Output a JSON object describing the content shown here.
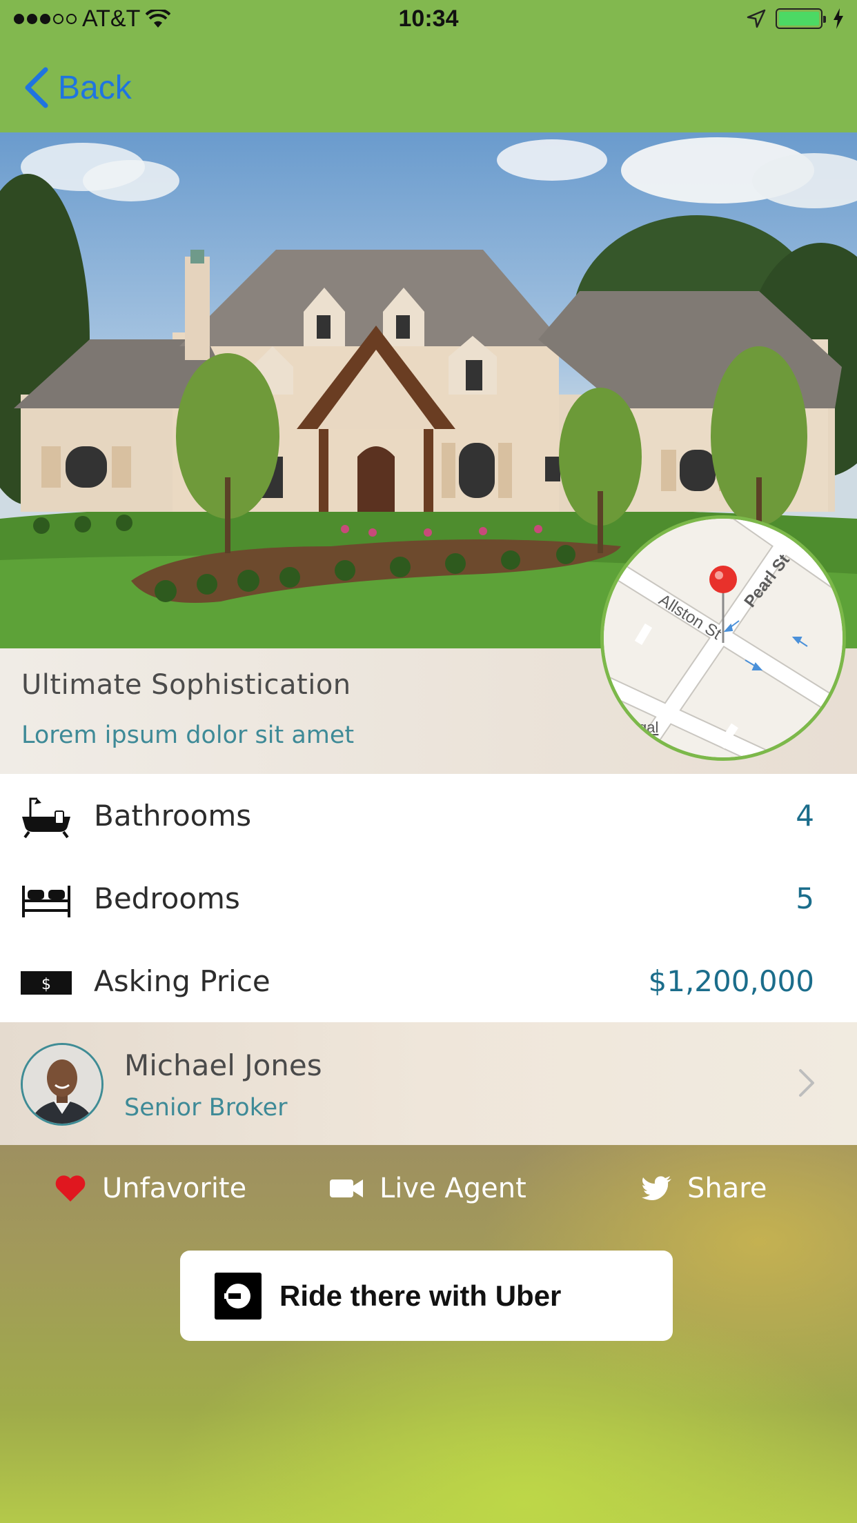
{
  "status_bar": {
    "carrier": "AT&T",
    "time": "10:34"
  },
  "nav": {
    "back_label": "Back"
  },
  "listing": {
    "title": "Ultimate Sophistication",
    "subtitle": "Lorem ipsum dolor sit amet"
  },
  "map": {
    "streets": [
      "Pearl St",
      "Allston St"
    ],
    "legal_fragment": "gal"
  },
  "details": [
    {
      "label": "Bathrooms",
      "value": "4",
      "icon": "bathtub-icon"
    },
    {
      "label": "Bedrooms",
      "value": "5",
      "icon": "bed-icon"
    },
    {
      "label": "Asking Price",
      "value": "$1,200,000",
      "icon": "dollar-bill-icon"
    }
  ],
  "agent": {
    "name": "Michael Jones",
    "role": "Senior Broker"
  },
  "actions": {
    "favorite_label": "Unfavorite",
    "live_agent_label": "Live Agent",
    "share_label": "Share"
  },
  "uber": {
    "label": "Ride there with Uber"
  },
  "colors": {
    "nav_green": "#82b84f",
    "ios_blue": "#1f74e0",
    "teal_text": "#3e8a97",
    "value_blue": "#1b6d8b",
    "heart_red": "#e0171f",
    "pin_red": "#e8312b"
  }
}
